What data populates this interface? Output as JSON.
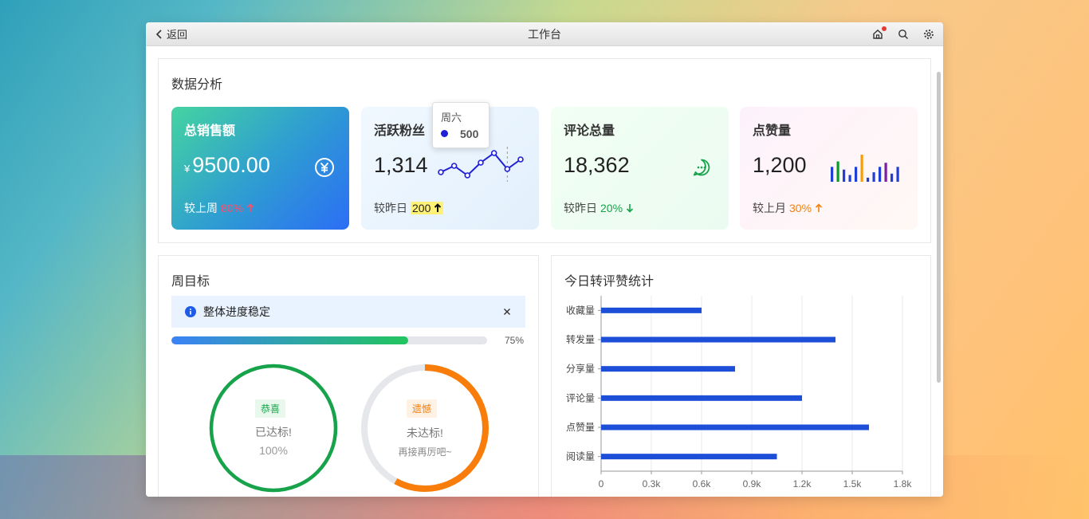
{
  "window": {
    "title": "工作台",
    "back_label": "返回"
  },
  "analysis": {
    "title": "数据分析",
    "sales": {
      "title": "总销售额",
      "currency": "¥",
      "value": "9500.00",
      "compare_label": "较上周",
      "compare_value": "80%",
      "trend": "up"
    },
    "fans": {
      "title": "活跃粉丝",
      "value": "1,314",
      "compare_label": "较昨日",
      "compare_value": "200",
      "trend": "up",
      "sparkline": [
        3,
        5,
        2,
        6,
        9,
        4,
        7
      ],
      "tooltip": {
        "label": "周六",
        "value": "500"
      }
    },
    "comments": {
      "title": "评论总量",
      "value": "18,362",
      "compare_label": "较昨日",
      "compare_value": "20%",
      "trend": "down"
    },
    "likes": {
      "title": "点赞量",
      "value": "1,200",
      "compare_label": "较上月",
      "compare_value": "30%",
      "trend": "up",
      "bars": [
        {
          "v": 0.55,
          "color": "#1f3fd6"
        },
        {
          "v": 0.75,
          "color": "#0a9a2a"
        },
        {
          "v": 0.45,
          "color": "#1f3fd6"
        },
        {
          "v": 0.25,
          "color": "#1f3fd6"
        },
        {
          "v": 0.55,
          "color": "#1f3fd6"
        },
        {
          "v": 1.0,
          "color": "#f59e0b"
        },
        {
          "v": 0.15,
          "color": "#1f3fd6"
        },
        {
          "v": 0.35,
          "color": "#1f3fd6"
        },
        {
          "v": 0.55,
          "color": "#1f3fd6"
        },
        {
          "v": 0.7,
          "color": "#7a1fa2"
        },
        {
          "v": 0.3,
          "color": "#1f3fd6"
        },
        {
          "v": 0.55,
          "color": "#1f3fd6"
        }
      ]
    }
  },
  "weekly": {
    "title": "周目标",
    "alert": "整体进度稳定",
    "progress": 75,
    "progress_label": "75%",
    "achieved": {
      "tag": "恭喜",
      "status": "已达标!",
      "percent": "100%",
      "value": 1.0
    },
    "missed": {
      "tag": "遗憾",
      "status": "未达标!",
      "note": "再接再厉吧~",
      "value": 0.58
    }
  },
  "today": {
    "title": "今日转评赞统计",
    "chart_data": {
      "type": "bar",
      "orientation": "horizontal",
      "categories": [
        "收藏量",
        "转发量",
        "分享量",
        "评论量",
        "点赞量",
        "阅读量"
      ],
      "values": [
        600,
        1400,
        800,
        1200,
        1600,
        1050
      ],
      "xlim": [
        0,
        1800
      ],
      "xticks": [
        0,
        300,
        600,
        900,
        1200,
        1500,
        1800
      ],
      "xtick_labels": [
        "0",
        "0.3k",
        "0.6k",
        "0.9k",
        "1.2k",
        "1.5k",
        "1.8k"
      ],
      "grid": true,
      "color": "#1d4ed8"
    }
  }
}
